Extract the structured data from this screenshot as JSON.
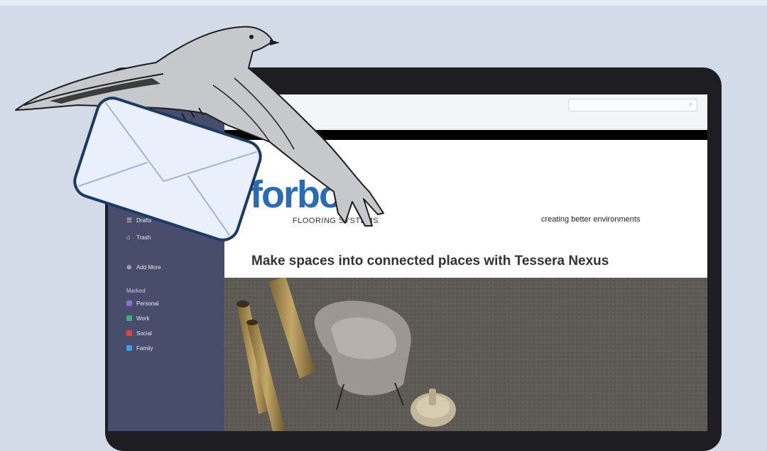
{
  "sidebar": {
    "items": [
      {
        "label": "Drafts",
        "icon": "drafts-icon"
      },
      {
        "label": "Trash",
        "icon": "trash-icon"
      }
    ],
    "add_more": "Add More",
    "section_title": "Marked",
    "labels": [
      {
        "label": "Personal",
        "color": "#8b6fd1"
      },
      {
        "label": "Work",
        "color": "#3db07a"
      },
      {
        "label": "Social",
        "color": "#e0443c"
      },
      {
        "label": "Family",
        "color": "#3aa0e6"
      }
    ]
  },
  "email": {
    "brand_logo": "forbo",
    "brand_sub": "FLOORING SYSTEMS",
    "tagline": "creating better environments",
    "headline": "Make spaces into connected places with Tessera Nexus"
  },
  "colors": {
    "background": "#d3dae8",
    "sidebar": "#474d6b",
    "brand_blue": "#2a6bb8"
  }
}
